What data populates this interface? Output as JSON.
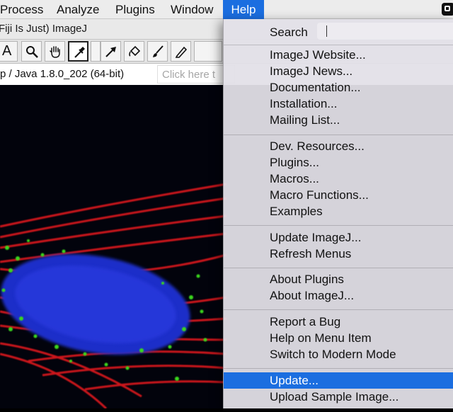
{
  "menubar": {
    "items": [
      {
        "label": "Process"
      },
      {
        "label": "Analyze"
      },
      {
        "label": "Plugins"
      },
      {
        "label": "Window"
      },
      {
        "label": "Help",
        "active": true
      }
    ]
  },
  "window": {
    "title": "Fiji Is Just) ImageJ"
  },
  "toolbar": {
    "tools": [
      {
        "name": "text-tool",
        "glyph": "A"
      },
      {
        "name": "magnifying-glass-tool"
      },
      {
        "name": "scrolling-hand-tool"
      },
      {
        "name": "color-picker-tool",
        "selected": true
      },
      {
        "name": "blank-tool-slot"
      },
      {
        "name": "arrow-tool"
      },
      {
        "name": "flood-fill-tool"
      },
      {
        "name": "paintbrush-tool"
      },
      {
        "name": "pencil-tool"
      },
      {
        "name": "blank-tool-slot"
      }
    ]
  },
  "status": {
    "text": "p / Java 1.8.0_202 (64-bit)",
    "search_placeholder": "Click here t"
  },
  "help_menu": {
    "search_label": "Search",
    "groups": [
      [
        "ImageJ Website...",
        "ImageJ News...",
        "Documentation...",
        "Installation...",
        "Mailing List..."
      ],
      [
        "Dev. Resources...",
        "Plugins...",
        "Macros...",
        "Macro Functions...",
        "Examples"
      ],
      [
        "Update ImageJ...",
        "Refresh Menus"
      ],
      [
        "About Plugins",
        "About ImageJ..."
      ],
      [
        "Report a Bug",
        "Help on Menu Item",
        "Switch to Modern Mode"
      ],
      [
        "Update...",
        "Upload Sample Image..."
      ]
    ],
    "highlighted_item": "Update..."
  },
  "colors": {
    "menu_highlight": "#1b6ee0",
    "nucleus": "#2233dd",
    "actin": "#e0181c",
    "mitochondria": "#38d61a"
  },
  "image": {
    "description_icon": "fluorescence-cell-image"
  }
}
